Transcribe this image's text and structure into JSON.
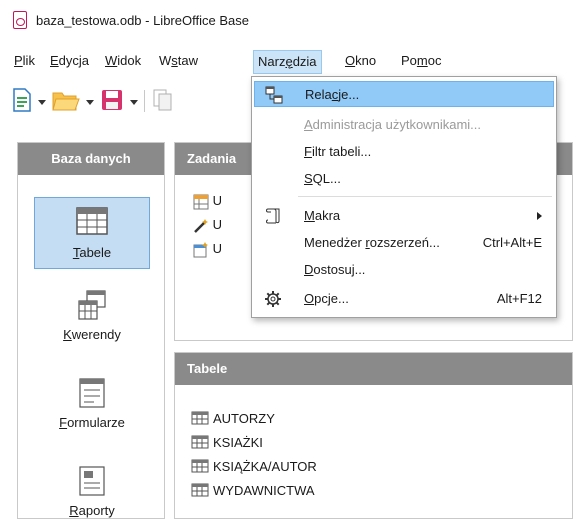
{
  "window": {
    "title": "baza_testowa.odb - LibreOffice Base"
  },
  "menubar": {
    "items": [
      {
        "label": "Plik",
        "accel": "P",
        "rest": "lik"
      },
      {
        "label": "Edycja",
        "accel": "E",
        "rest": "dycja"
      },
      {
        "label": "Widok",
        "accel": "W",
        "rest": "idok"
      },
      {
        "label": "Wstaw",
        "pre": "W",
        "accel": "s",
        "rest": "taw"
      },
      {
        "label": "Narzędzia",
        "pre": "Narz",
        "accel": "ę",
        "rest": "dzia"
      },
      {
        "label": "Okno",
        "accel": "O",
        "rest": "kno"
      },
      {
        "label": "Pomoc",
        "pre": "Po",
        "accel": "m",
        "rest": "oc"
      }
    ]
  },
  "left_panel": {
    "header": "Baza danych",
    "items": [
      {
        "label": "Tabele",
        "accel": "T",
        "rest": "abele",
        "selected": true,
        "icon": "table-icon"
      },
      {
        "label": "Kwerendy",
        "accel": "K",
        "rest": "werendy",
        "icon": "query-icon"
      },
      {
        "label": "Formularze",
        "accel": "F",
        "rest": "ormularze",
        "icon": "form-icon"
      },
      {
        "label": "Raporty",
        "accel": "R",
        "rest": "aporty",
        "icon": "report-icon"
      }
    ]
  },
  "tasks_panel": {
    "header": "Zadania",
    "items": [
      "U",
      "U",
      "U"
    ]
  },
  "tables_panel": {
    "header": "Tabele",
    "items": [
      "AUTORZY",
      "KSIAŻKI",
      "KSIĄŻKA/AUTOR",
      "WYDAWNICTWA"
    ]
  },
  "dropdown": {
    "items": [
      {
        "pre": "Rela",
        "accel": "c",
        "rest": "je...",
        "highlighted": true,
        "icon": "relations-icon"
      },
      {
        "pre": "",
        "accel": "A",
        "rest": "dministracja użytkownikami...",
        "disabled": true
      },
      {
        "pre": "",
        "accel": "F",
        "rest": "iltr tabeli..."
      },
      {
        "pre": "",
        "accel": "S",
        "rest": "QL..."
      },
      {
        "pre": "",
        "accel": "M",
        "rest": "akra",
        "submenu": true,
        "icon": "macro-icon"
      },
      {
        "pre": "Menedżer ",
        "accel": "r",
        "rest": "ozszerzeń...",
        "shortcut": "Ctrl+Alt+E"
      },
      {
        "pre": "",
        "accel": "D",
        "rest": "ostosuj..."
      },
      {
        "pre": "",
        "accel": "O",
        "rest": "pcje...",
        "shortcut": "Alt+F12",
        "icon": "options-gear-icon"
      }
    ]
  }
}
